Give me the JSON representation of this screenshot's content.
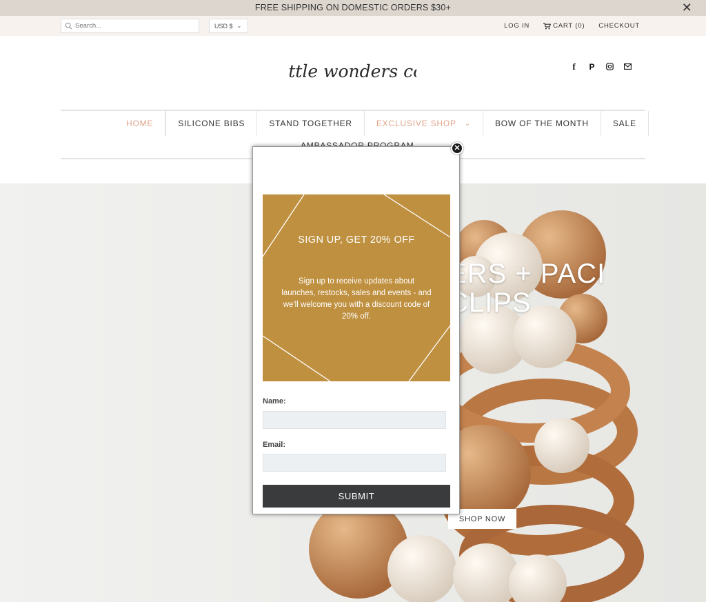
{
  "announcement": {
    "text": "FREE SHIPPING ON DOMESTIC ORDERS $30+",
    "close": "✕"
  },
  "utility": {
    "search_placeholder": "Search...",
    "currency": "USD $",
    "login": "LOG IN",
    "cart": "CART (0)",
    "checkout": "CHECKOUT"
  },
  "header": {
    "logo_text": "little wonders co."
  },
  "social": {
    "icons": [
      "facebook-icon",
      "pinterest-icon",
      "instagram-icon",
      "mail-icon"
    ]
  },
  "nav": {
    "items": [
      {
        "label": "HOME"
      },
      {
        "label": "SILICONE BIBS"
      },
      {
        "label": "STAND TOGETHER"
      },
      {
        "label": "EXCLUSIVE SHOP"
      },
      {
        "label": "BOW OF THE MONTH"
      },
      {
        "label": "SALE"
      }
    ],
    "row2": "AMBASSADOR PROGRAM"
  },
  "hero": {
    "title_line1": "ERS + PACI",
    "title_line2": "CLIPS",
    "cta": "SHOP NOW"
  },
  "popup": {
    "close": "✕",
    "promo_title": "SIGN UP, GET 20% OFF",
    "promo_body": "Sign up to receive updates about launches, restocks, sales and events - and we'll welcome you with a discount code of 20% off.",
    "name_label": "Name:",
    "email_label": "Email:",
    "submit": "SUBMIT"
  },
  "colors": {
    "announcement_bg": "#ddd6cf",
    "accent": "#e0a58a",
    "promo_bg": "#bf9040",
    "submit_bg": "#3a3b3d"
  }
}
